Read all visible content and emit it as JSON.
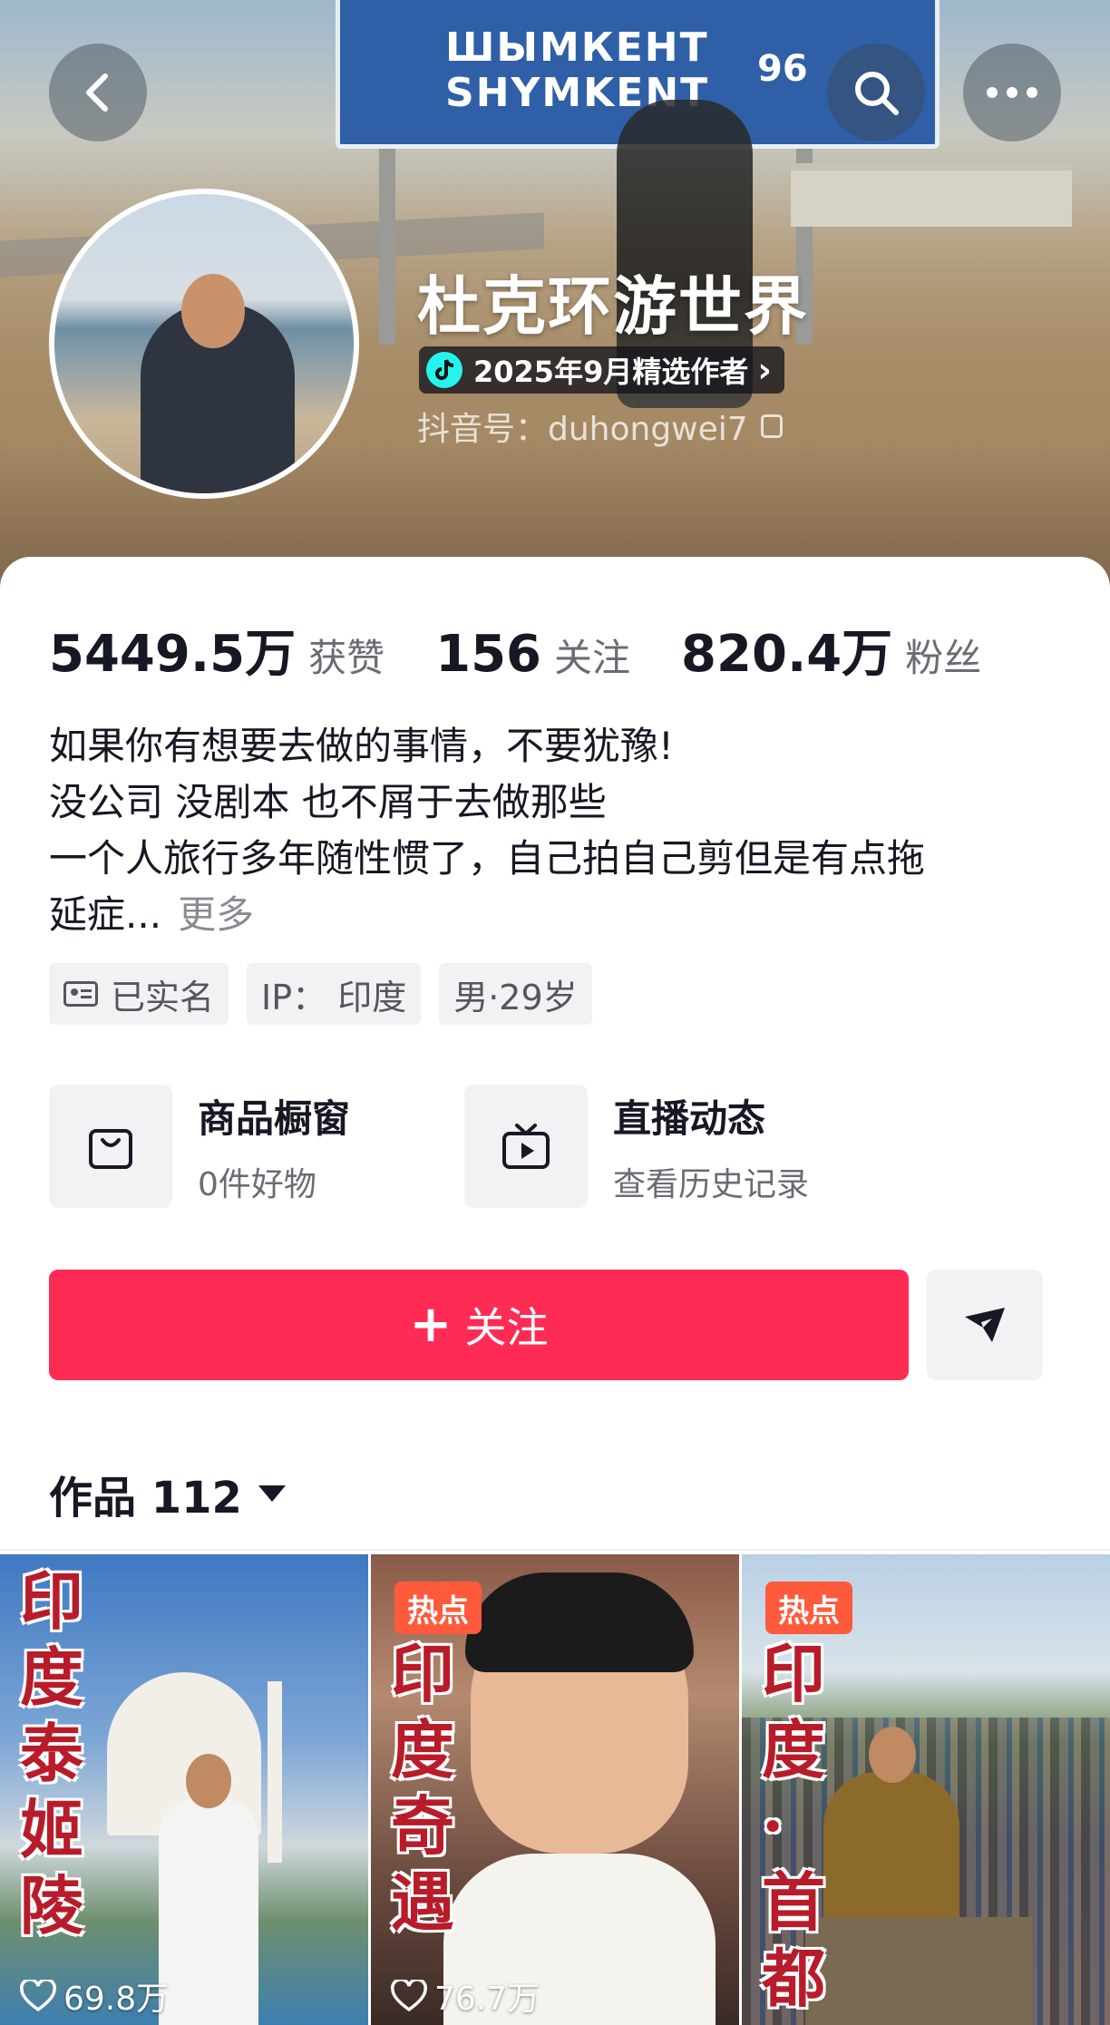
{
  "header": {
    "back_icon": "chevron-left-icon",
    "search_icon": "search-icon",
    "more_icon": "more-dots-icon",
    "sign_line1": "ШЫМКЕНТ",
    "sign_line2": "SHYMKENT",
    "sign_number": "96"
  },
  "profile": {
    "nickname": "杜克环游世界",
    "badge": "2025年9月精选作者",
    "badge_chevron": "›",
    "douyin_id": "抖音号：duhongwei7"
  },
  "stats": [
    {
      "value": "5449.5万",
      "label": "获赞"
    },
    {
      "value": "156",
      "label": "关注"
    },
    {
      "value": "820.4万",
      "label": "粉丝"
    }
  ],
  "bio": {
    "line1": "如果你有想要去做的事情，不要犹豫!",
    "line2": "没公司 没剧本 也不屑于去做那些",
    "line3": "一个人旅行多年随性惯了，自己拍自己剪但是有点拖",
    "line4": "延症...",
    "more": "更多"
  },
  "tags": {
    "verified": "已实名",
    "ip": "IP：  印度",
    "gender_age": "男·29岁"
  },
  "features": {
    "shop_title": "商品橱窗",
    "shop_sub": "0件好物",
    "live_title": "直播动态",
    "live_sub": "查看历史记录"
  },
  "actions": {
    "follow_plus": "+",
    "follow_label": "关注"
  },
  "works": {
    "label": "作品 112"
  },
  "videos": [
    {
      "title": "印度泰姬陵",
      "likes": "69.8万",
      "hot": ""
    },
    {
      "title": "印度奇遇",
      "likes": "76.7万",
      "hot": "热点"
    },
    {
      "title": "印度·首都",
      "likes": "",
      "hot": "热点"
    }
  ],
  "colors": {
    "accent": "#fe2c55",
    "hot_tag": "#ff5a3c",
    "text_primary": "#161823",
    "text_secondary": "#6b6c73"
  }
}
